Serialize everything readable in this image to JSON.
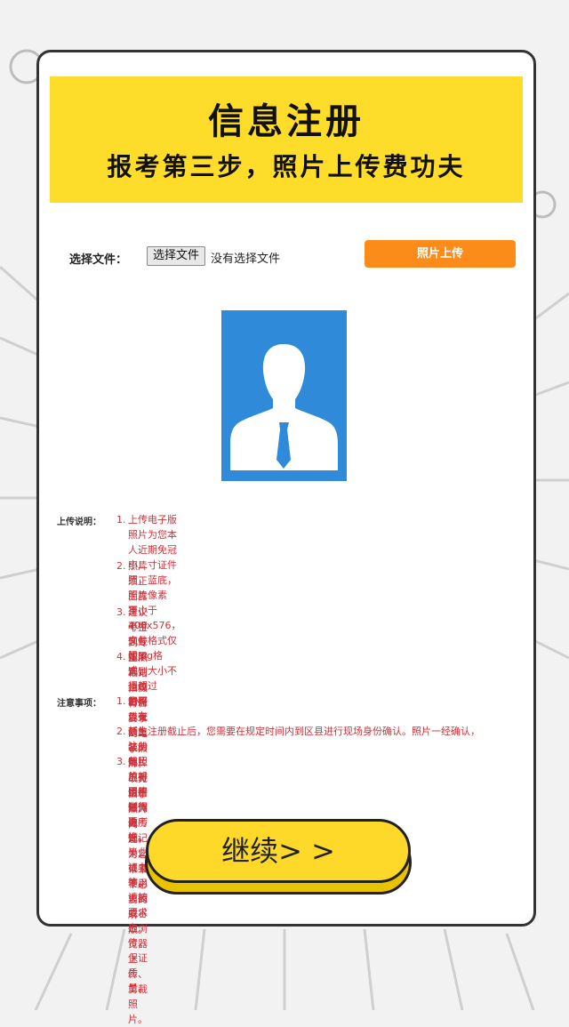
{
  "banner": {
    "title": "信息注册",
    "subtitle": "报考第三步，照片上传费功夫"
  },
  "upload": {
    "file_label": "选择文件：",
    "choose_button": "选择文件",
    "file_status": "没有选择文件",
    "upload_button": "照片上传"
  },
  "photo": {
    "icon": "person-silhouette-icon",
    "background_color": "#2f8ad9"
  },
  "instructions": {
    "heading": "上传说明：",
    "items": [
      {
        "num": "1.",
        "text": "上传电子版照片为您本人近期免冠小二寸证件照，蓝底，照片像素\n不小于400x576，文件格式仅限jpg格式，大小不得超过5M。"
      },
      {
        "num": "2.",
        "text": "照片须正面露耳，不得佩戴帽饰，建议着深色有领上装。照片不得\n进行任何修饰。"
      },
      {
        "num": "3.",
        "text": "建议考生到专业照相馆拍摄符合要求的电子照片，以免由于照片问\n题，为您带来不必要的麻烦。"
      },
      {
        "num": "4.",
        "text": "如果遇到上传的照片无法剪裁的情况，请删除浏览历史记录，或者\n使用火狐或谷歌浏览器上传、剪裁照片。"
      }
    ]
  },
  "notices": {
    "heading": "注意事项：",
    "items": [
      {
        "num": "1.",
        "text": "您可以在新生注册截止前对照片进行更换。"
      },
      {
        "num": "2.",
        "text": "新生注册截止后，您需要在规定时间内到区县进行现场身份确认。照片一经确认，"
      },
      {
        "num": "3.",
        "text": "此照片将用于制作准考证、毕业证书等，请按要求上传，保证质量。"
      }
    ]
  },
  "continue_button": "继续> >",
  "colors": {
    "banner": "#fedc2a",
    "upload_button": "#fc8c1a",
    "notes_text": "#d0323a",
    "continue_button": "#fed92a"
  }
}
